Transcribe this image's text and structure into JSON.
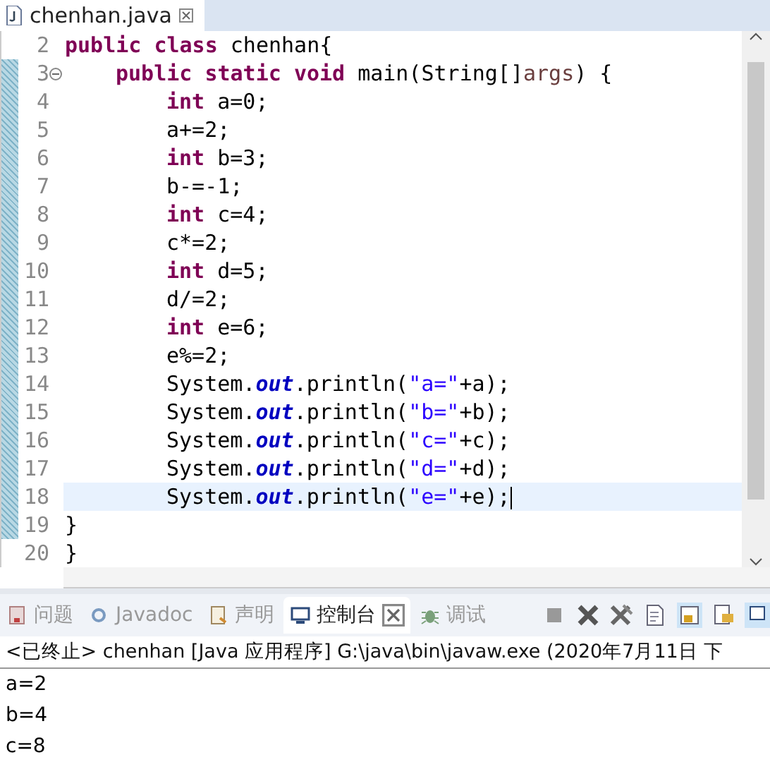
{
  "editor_tab": {
    "title": "chenhan.java",
    "closable": true,
    "selected": true
  },
  "lines": [
    {
      "number": "2",
      "fold": false,
      "current": false,
      "tokens": [
        {
          "kind": "keyword",
          "text": "public "
        },
        {
          "kind": "keyword",
          "text": "class "
        },
        {
          "kind": "plain",
          "text": "chenhan{"
        }
      ],
      "children": [
        {
          "number": "3",
          "fold": true,
          "current": false,
          "tokens": [
            {
              "kind": "keyword",
              "text": "public "
            },
            {
              "kind": "keyword",
              "text": "static "
            },
            {
              "kind": "keyword",
              "text": "void "
            },
            {
              "kind": "plain",
              "text": "main(String[]"
            },
            {
              "kind": "param",
              "text": "args"
            },
            {
              "kind": "plain",
              "text": ") {"
            }
          ],
          "children": [
            {
              "number": "4",
              "fold": false,
              "current": false,
              "tokens": [
                {
                  "kind": "keyword",
                  "text": "int "
                },
                {
                  "kind": "plain",
                  "text": "a=0;"
                }
              ]
            },
            {
              "number": "5",
              "fold": false,
              "current": false,
              "tokens": [
                {
                  "kind": "plain",
                  "text": "a+=2;"
                }
              ]
            },
            {
              "number": "6",
              "fold": false,
              "current": false,
              "tokens": [
                {
                  "kind": "keyword",
                  "text": "int "
                },
                {
                  "kind": "plain",
                  "text": "b=3;"
                }
              ]
            },
            {
              "number": "7",
              "fold": false,
              "current": false,
              "tokens": [
                {
                  "kind": "plain",
                  "text": "b-=-1;"
                }
              ]
            },
            {
              "number": "8",
              "fold": false,
              "current": false,
              "tokens": [
                {
                  "kind": "keyword",
                  "text": "int "
                },
                {
                  "kind": "plain",
                  "text": "c=4;"
                }
              ]
            },
            {
              "number": "9",
              "fold": false,
              "current": false,
              "tokens": [
                {
                  "kind": "plain",
                  "text": "c*=2;"
                }
              ]
            },
            {
              "number": "10",
              "fold": false,
              "current": false,
              "tokens": [
                {
                  "kind": "keyword",
                  "text": "int "
                },
                {
                  "kind": "plain",
                  "text": "d=5;"
                }
              ]
            },
            {
              "number": "11",
              "fold": false,
              "current": false,
              "tokens": [
                {
                  "kind": "plain",
                  "text": "d/=2;"
                }
              ]
            },
            {
              "number": "12",
              "fold": false,
              "current": false,
              "tokens": [
                {
                  "kind": "keyword",
                  "text": "int "
                },
                {
                  "kind": "plain",
                  "text": "e=6;"
                }
              ]
            },
            {
              "number": "13",
              "fold": false,
              "current": false,
              "tokens": [
                {
                  "kind": "plain",
                  "text": "e%=2;"
                }
              ]
            },
            {
              "number": "14",
              "fold": false,
              "current": false,
              "tokens": [
                {
                  "kind": "plain",
                  "text": "System."
                },
                {
                  "kind": "field",
                  "text": "out"
                },
                {
                  "kind": "plain",
                  "text": ".println("
                },
                {
                  "kind": "string",
                  "text": "\"a=\""
                },
                {
                  "kind": "plain",
                  "text": "+a);"
                }
              ]
            },
            {
              "number": "15",
              "fold": false,
              "current": false,
              "tokens": [
                {
                  "kind": "plain",
                  "text": "System."
                },
                {
                  "kind": "field",
                  "text": "out"
                },
                {
                  "kind": "plain",
                  "text": ".println("
                },
                {
                  "kind": "string",
                  "text": "\"b=\""
                },
                {
                  "kind": "plain",
                  "text": "+b);"
                }
              ]
            },
            {
              "number": "16",
              "fold": false,
              "current": false,
              "tokens": [
                {
                  "kind": "plain",
                  "text": "System."
                },
                {
                  "kind": "field",
                  "text": "out"
                },
                {
                  "kind": "plain",
                  "text": ".println("
                },
                {
                  "kind": "string",
                  "text": "\"c=\""
                },
                {
                  "kind": "plain",
                  "text": "+c);"
                }
              ]
            },
            {
              "number": "17",
              "fold": false,
              "current": false,
              "tokens": [
                {
                  "kind": "plain",
                  "text": "System."
                },
                {
                  "kind": "field",
                  "text": "out"
                },
                {
                  "kind": "plain",
                  "text": ".println("
                },
                {
                  "kind": "string",
                  "text": "\"d=\""
                },
                {
                  "kind": "plain",
                  "text": "+d);"
                }
              ]
            },
            {
              "number": "18",
              "fold": false,
              "current": true,
              "tokens": [
                {
                  "kind": "plain",
                  "text": "System."
                },
                {
                  "kind": "field",
                  "text": "out"
                },
                {
                  "kind": "plain",
                  "text": ".println("
                },
                {
                  "kind": "string",
                  "text": "\"e=\""
                },
                {
                  "kind": "plain",
                  "text": "+e);"
                }
              ]
            }
          ]
        }
      ]
    },
    {
      "number": "19",
      "fold": false,
      "current": false,
      "tokens": [
        {
          "kind": "plain",
          "text": "}"
        }
      ]
    },
    {
      "number": "20",
      "fold": false,
      "current": false,
      "tokens": [
        {
          "kind": "plain",
          "text": "}"
        }
      ]
    }
  ],
  "console_tabs": [
    {
      "label": "问题",
      "kind": "problems",
      "selected": false,
      "closable": false
    },
    {
      "label": "Javadoc",
      "kind": "javadoc",
      "selected": false,
      "closable": false
    },
    {
      "label": "声明",
      "kind": "declaration",
      "selected": false,
      "closable": false
    },
    {
      "label": "控制台",
      "kind": "console",
      "selected": true,
      "closable": true
    },
    {
      "label": "调试",
      "kind": "debug",
      "selected": false,
      "closable": false
    }
  ],
  "console": {
    "header": "<已终止> chenhan [Java 应用程序] G:\\java\\bin\\javaw.exe  (2020年7月11日 下",
    "output": [
      "a=2",
      "b=4",
      "c=8"
    ]
  }
}
